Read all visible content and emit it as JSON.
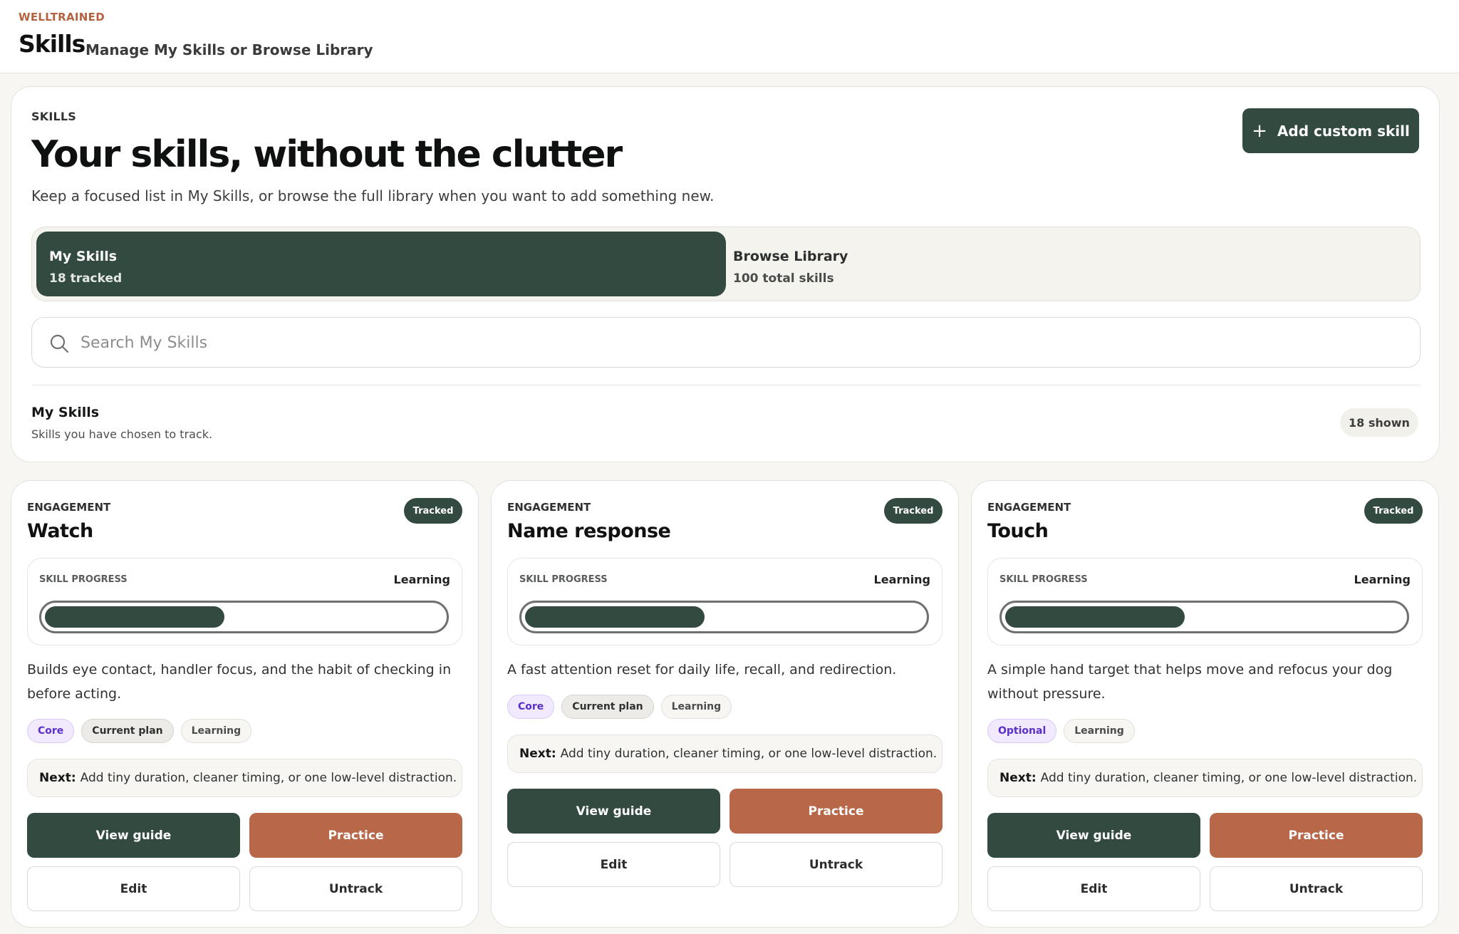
{
  "header": {
    "brand": "WELLTRAINED",
    "title": "Skills",
    "subtitle": "Manage My Skills or Browse Library"
  },
  "hero": {
    "kicker": "SKILLS",
    "title": "Your skills, without the clutter",
    "description": "Keep a focused list in My Skills, or browse the full library when you want to add something new.",
    "add_button": "Add custom skill",
    "add_icon": "plus-icon"
  },
  "toggle": {
    "my_skills": {
      "label": "My Skills",
      "sub": "18 tracked"
    },
    "library": {
      "label": "Browse Library",
      "sub": "100 total skills"
    }
  },
  "search": {
    "placeholder": "Search My Skills",
    "value": "",
    "icon": "search-icon"
  },
  "list": {
    "title": "My Skills",
    "subtitle": "Skills you have chosen to track.",
    "count": "18 shown"
  },
  "colors": {
    "primary": "#334a41",
    "accent": "#b86748",
    "brand": "#b4623f",
    "tag_core": "#5b2fc9"
  },
  "cards": [
    {
      "category": "ENGAGEMENT",
      "title": "Watch",
      "badge": "Tracked",
      "progress_label": "SKILL PROGRESS",
      "progress_status": "Learning",
      "progress": 0.45,
      "description": "Builds eye contact, handler focus, and the habit of checking in before acting.",
      "tags": [
        "Core",
        "Current plan",
        "Learning"
      ],
      "next_label": "Next:",
      "next_text": "Add tiny duration, cleaner timing, or one low-level distraction.",
      "buttons": {
        "guide": "View guide",
        "practice": "Practice",
        "edit": "Edit",
        "untrack": "Untrack"
      }
    },
    {
      "category": "ENGAGEMENT",
      "title": "Name response",
      "badge": "Tracked",
      "progress_label": "SKILL PROGRESS",
      "progress_status": "Learning",
      "progress": 0.45,
      "description": "A fast attention reset for daily life, recall, and redirection.",
      "tags": [
        "Core",
        "Current plan",
        "Learning"
      ],
      "next_label": "Next:",
      "next_text": "Add tiny duration, cleaner timing, or one low-level distraction.",
      "buttons": {
        "guide": "View guide",
        "practice": "Practice",
        "edit": "Edit",
        "untrack": "Untrack"
      }
    },
    {
      "category": "ENGAGEMENT",
      "title": "Touch",
      "badge": "Tracked",
      "progress_label": "SKILL PROGRESS",
      "progress_status": "Learning",
      "progress": 0.45,
      "description": "A simple hand target that helps move and refocus your dog without pressure.",
      "tags": [
        "Optional",
        "Learning"
      ],
      "next_label": "Next:",
      "next_text": "Add tiny duration, cleaner timing, or one low-level distraction.",
      "buttons": {
        "guide": "View guide",
        "practice": "Practice",
        "edit": "Edit",
        "untrack": "Untrack"
      }
    }
  ]
}
